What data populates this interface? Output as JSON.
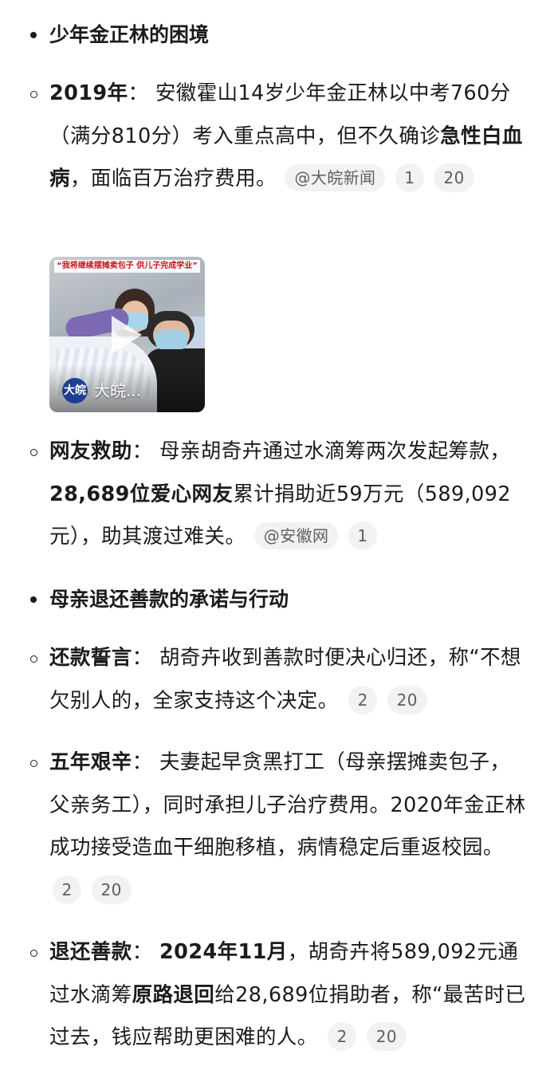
{
  "sections": [
    {
      "bullet_type": "disc",
      "title": "少年金正林的困境"
    },
    {
      "bullet_type": "disc",
      "title": "母亲退还善款的承诺与行动"
    }
  ],
  "items": {
    "y2019": {
      "label": "2019年",
      "colon": "：",
      "text1": "安徽霍山14岁少年金正林以中考760分（满分810分）考入重点高中，但不久确诊",
      "bold1": "急性白血病",
      "text2": "，面临百万治疗费用。",
      "source": "@大皖新闻",
      "refs": [
        "1",
        "20"
      ]
    },
    "video": {
      "banner": "“我将继续摆摊卖包子 供儿子完成学业”",
      "logo": "大皖",
      "caption": "大皖..."
    },
    "help": {
      "label": "网友救助",
      "colon": "：",
      "text1": "母亲胡奇卉通过水滴筹两次发起筹款，",
      "bold1": "28,689位爱心网友",
      "text2": "累计捐助近59万元（589,092元），助其渡过难关。",
      "source": "@安徽网",
      "refs": [
        "1"
      ]
    },
    "vow": {
      "label": "还款誓言",
      "colon": "：",
      "text1": "胡奇卉收到善款时便决心归还，称“不想欠别人的，全家支持这个决定。",
      "refs": [
        "2",
        "20"
      ]
    },
    "hardship": {
      "label": "五年艰辛",
      "colon": "：",
      "text1": "夫妻起早贪黑打工（母亲摆摊卖包子，父亲务工），同时承担儿子治疗费用。2020年金正林成功接受造血干细胞移植，病情稳定后重返校园。",
      "refs": [
        "2",
        "20"
      ]
    },
    "refund": {
      "label": "退还善款",
      "colon": "：",
      "bold0": "2024年11月",
      "text1": "，胡奇卉将589,092元通过水滴筹",
      "bold1": "原路退回",
      "text2": "给28,689位捐助者，称“最苦时已过去，钱应帮助更困难的人。",
      "refs": [
        "2",
        "20"
      ]
    }
  }
}
